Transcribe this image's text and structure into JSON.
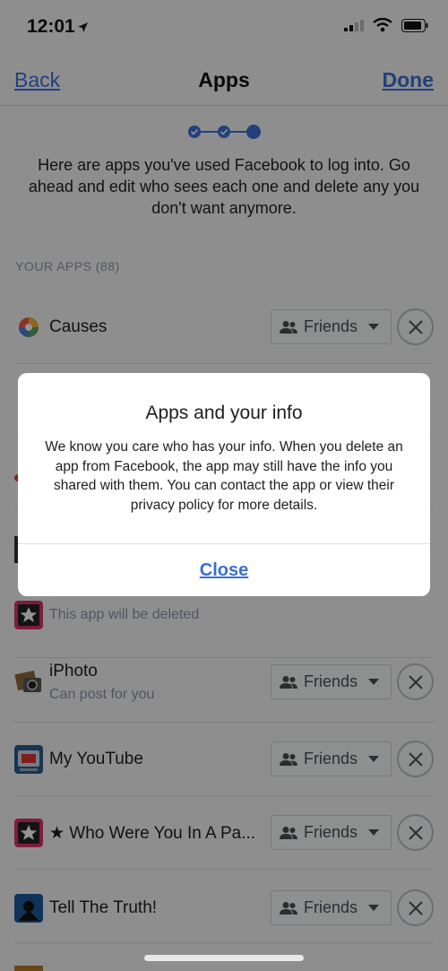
{
  "status": {
    "time": "12:01"
  },
  "nav": {
    "back": "Back",
    "title": "Apps",
    "done": "Done"
  },
  "intro": "Here are apps you've used Facebook to log into. Go ahead and edit who sees each one and delete any you don't want anymore.",
  "section_header": "YOUR APPS (88)",
  "apps": [
    {
      "name": "Causes",
      "audience": "Friends",
      "icon": "causes-app-icon"
    },
    {
      "sub": "This app will be deleted",
      "icon": "star-app-icon"
    },
    {
      "name": "iPhoto",
      "sub": "Can post for you",
      "audience": "Friends",
      "icon": "iphoto-app-icon"
    },
    {
      "name": "My YouTube",
      "audience": "Friends",
      "icon": "youtube-app-icon"
    },
    {
      "name": "★ Who Were You In A Pa...",
      "audience": "Friends",
      "icon": "star-app-icon"
    },
    {
      "name": "Tell The Truth!",
      "audience": "Friends",
      "icon": "truth-app-icon"
    }
  ],
  "modal": {
    "title": "Apps and your info",
    "body": "We know you care who has your info. When you delete an app from Facebook, the app may still have the info you shared with them. You can contact the app or view their privacy policy for more details.",
    "close": "Close"
  },
  "colors": {
    "accent": "#3b6fd4",
    "overlay": "rgba(0,0,0,0.42)",
    "background": "#f4f5f7"
  }
}
